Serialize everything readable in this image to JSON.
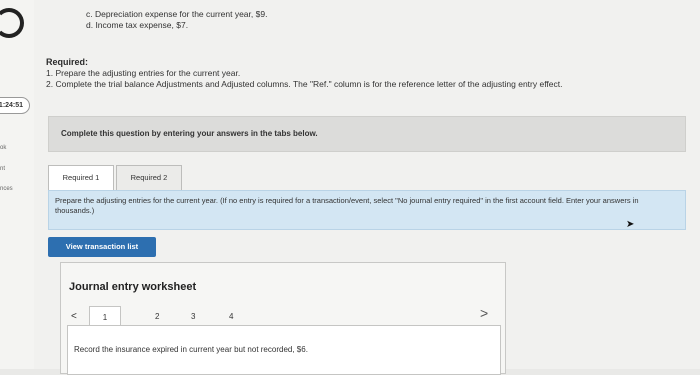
{
  "sidebar": {
    "timer": "1:24:51",
    "item1": "ok",
    "item2": "nt",
    "item3": "nces"
  },
  "prev_items": {
    "c": "c. Depreciation expense for the current year, $9.",
    "d": "d. Income tax expense, $7."
  },
  "required": {
    "title": "Required:",
    "line1": "1. Prepare the adjusting entries for the current year.",
    "line2": "2. Complete the trial balance Adjustments and Adjusted columns. The \"Ref.\" column is for the reference letter of the adjusting entry effect."
  },
  "instruction": "Complete this question by entering your answers in the tabs below.",
  "tabs": [
    "Required 1",
    "Required 2"
  ],
  "prompt": "Prepare the adjusting entries for the current year. (If no entry is required for a transaction/event, select \"No journal entry required\" in the first account field. Enter your answers in thousands.)",
  "view_button": "View transaction list",
  "worksheet": {
    "title": "Journal entry worksheet",
    "prev": "<",
    "pages": [
      "1",
      "2",
      "3",
      "4"
    ],
    "next": ">",
    "record_text": "Record the insurance expired in current year but not recorded, $6."
  }
}
